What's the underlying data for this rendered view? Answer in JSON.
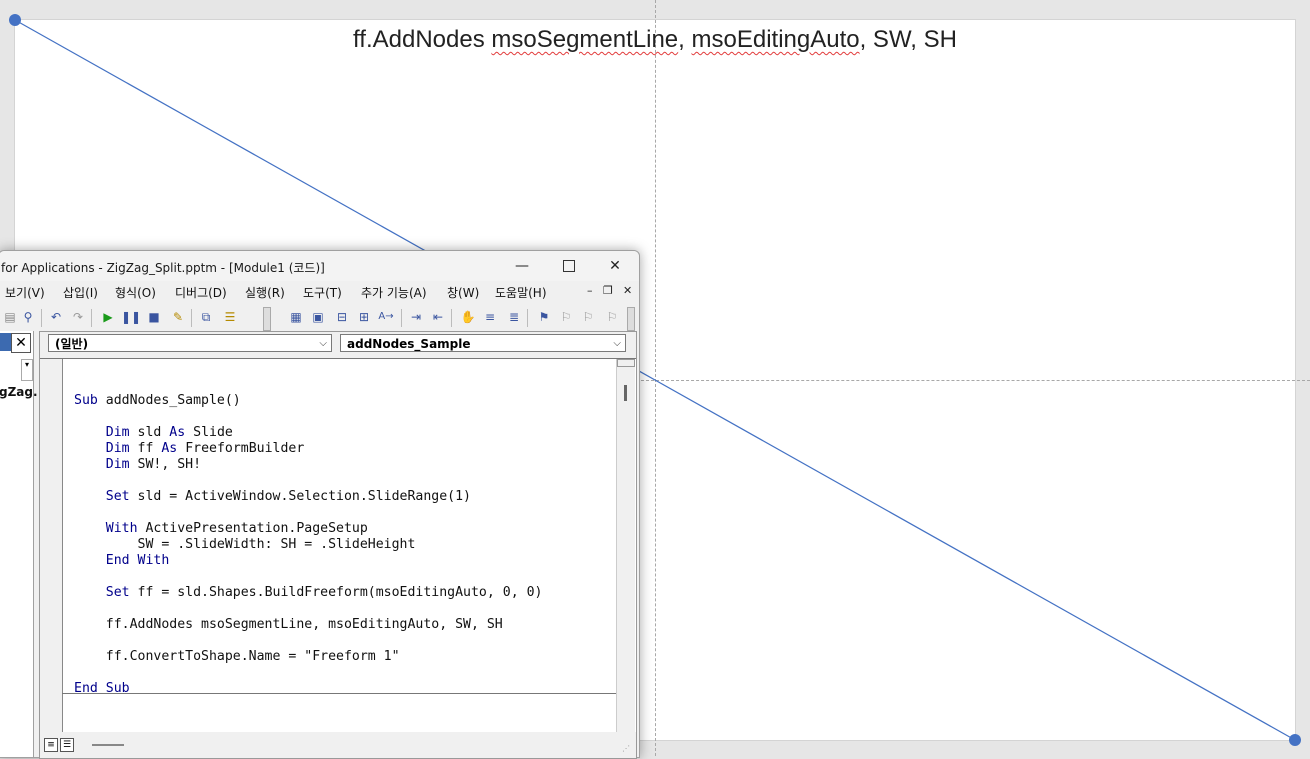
{
  "slide": {
    "title_prefix": "ff.AddNodes",
    "title_token1": "msoSegmentLine",
    "title_mid": ", ",
    "title_token2": "msoEditingAuto",
    "title_suffix": ", SW, SH",
    "line_color": "#4472c4",
    "handle_color": "#4472c4"
  },
  "vbe": {
    "title": "for Applications - ZigZag_Split.pptm - [Module1 (코드)]",
    "window_buttons": {
      "minimize": "—",
      "close": "✕"
    },
    "menu": [
      "보기(V)",
      "삽입(I)",
      "형식(O)",
      "디버그(D)",
      "실행(R)",
      "도구(T)",
      "추가 기능(A)",
      "창(W)",
      "도움말(H)"
    ],
    "mdi_buttons": {
      "minimize": "–",
      "restore": "❐",
      "close": "✕"
    },
    "project_pane": {
      "close": "✕",
      "node_label": "gZag."
    },
    "combo_object": "(일반)",
    "combo_procedure": "addNodes_Sample",
    "combo_arrow": "⌵",
    "code": {
      "l1_kw": "Sub",
      "l1_rest": " addNodes_Sample()",
      "l2_kw1": "Dim",
      "l2_mid": " sld ",
      "l2_kw2": "As",
      "l2_rest": " Slide",
      "l3_kw1": "Dim",
      "l3_mid": " ff ",
      "l3_kw2": "As",
      "l3_rest": " FreeformBuilder",
      "l4_kw": "Dim",
      "l4_rest": " SW!, SH!",
      "l5_kw": "Set",
      "l5_rest": " sld = ActiveWindow.Selection.SlideRange(1)",
      "l6_kw": "With",
      "l6_rest": " ActivePresentation.PageSetup",
      "l7": "SW = .SlideWidth: SH = .SlideHeight",
      "l8_kw": "End With",
      "l9_kw": "Set",
      "l9_rest": " ff = sld.Shapes.BuildFreeform(msoEditingAuto, 0, 0)",
      "l10": "ff.AddNodes msoSegmentLine, msoEditingAuto, SW, SH",
      "l11": "ff.ConvertToShape.Name = \"Freeform 1\"",
      "l12_kw": "End Sub"
    }
  }
}
